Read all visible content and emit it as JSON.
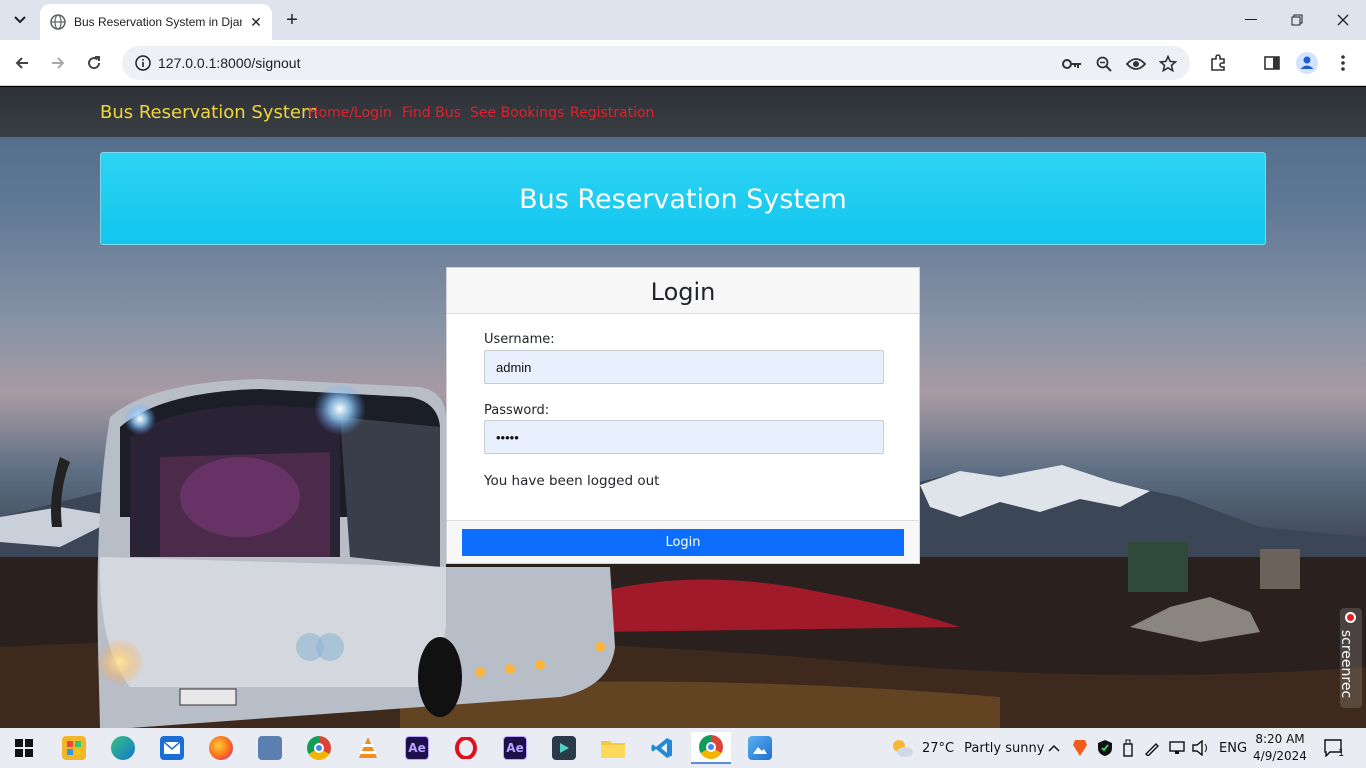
{
  "browser": {
    "tab_title": "Bus Reservation System in Djan",
    "url": "127.0.0.1:8000/signout",
    "new_tab_label": "+",
    "close_tab_label": "✕"
  },
  "site": {
    "brand": "Bus Reservation System",
    "nav": [
      {
        "label": "Home/Login"
      },
      {
        "label": "Find Bus"
      },
      {
        "label": "See Bookings"
      },
      {
        "label": "Registration"
      }
    ],
    "banner_title": "Bus Reservation System"
  },
  "login": {
    "title": "Login",
    "username_label": "Username:",
    "username_value": "admin",
    "password_label": "Password:",
    "password_value": "•••••",
    "message": "You have been logged out",
    "button_label": "Login"
  },
  "overlay": {
    "screenrec_label": "screenrec"
  },
  "taskbar": {
    "weather_temp": "27°C",
    "weather_text": "Partly sunny",
    "language": "ENG",
    "time": "8:20 AM",
    "date": "4/9/2024",
    "notification_count": "1"
  },
  "colors": {
    "nav_link": "#e21f2b",
    "brand": "#f1d53b",
    "banner": "#18c8ef",
    "button": "#0d6efd"
  }
}
